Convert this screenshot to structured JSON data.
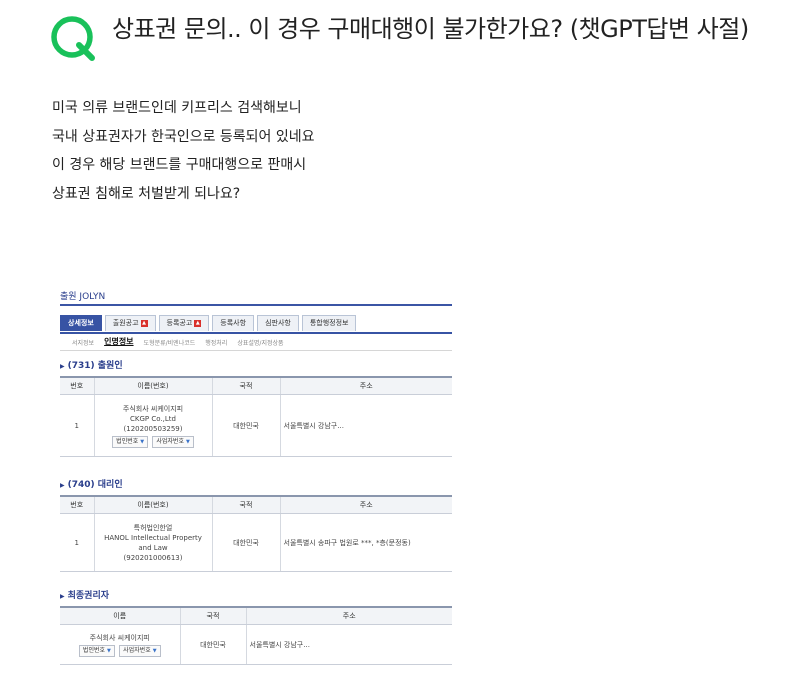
{
  "question": {
    "icon": "Q",
    "title": "상표권 문의.. 이 경우 구매대행이 불가한가요? (챗GPT답변 사절)",
    "body_lines": [
      "미국 의류 브랜드인데 키프리스 검색해보니",
      "국내 상표권자가 한국인으로 등록되어 있네요",
      "이 경우 해당 브랜드를 구매대행으로 판매시",
      "상표권 침해로 처벌받게 되나요?"
    ]
  },
  "screenshot": {
    "title": "출원 JOLYN",
    "tabs": [
      {
        "label": "상세정보",
        "active": true,
        "pdf": false
      },
      {
        "label": "출원공고",
        "active": false,
        "pdf": true
      },
      {
        "label": "등록공고",
        "active": false,
        "pdf": true
      },
      {
        "label": "등록사항",
        "active": false,
        "pdf": false
      },
      {
        "label": "심판사항",
        "active": false,
        "pdf": false
      },
      {
        "label": "통합행정정보",
        "active": false,
        "pdf": false
      }
    ],
    "subtabs": [
      {
        "label": "서지정보",
        "active": false
      },
      {
        "label": "인명정보",
        "active": true
      },
      {
        "label": "도형분류/비엔나코드",
        "active": false
      },
      {
        "label": "행정처리",
        "active": false
      },
      {
        "label": "상표설명/지정상품",
        "active": false
      }
    ],
    "applicant": {
      "heading": "(731) 출원인",
      "headers": [
        "번호",
        "이름(번호)",
        "국적",
        "주소"
      ],
      "row": {
        "no": "1",
        "name_lines": [
          "주식회사 씨케이지피",
          "CKGP Co.,Ltd",
          "(120200503259)"
        ],
        "buttons": [
          "법인번호",
          "사업자번호"
        ],
        "nationality": "대한민국",
        "address": "서울특별시 강남구..."
      }
    },
    "agent": {
      "heading": "(740) 대리인",
      "headers": [
        "번호",
        "이름(번호)",
        "국적",
        "주소"
      ],
      "row": {
        "no": "1",
        "name_lines": [
          "특허법인한얼",
          "HANOL Intellectual Property",
          "and Law",
          "(920201000613)"
        ],
        "nationality": "대한민국",
        "address": "서울특별시 송파구 법원로 ***, *층(문정동)"
      }
    },
    "owner": {
      "heading": "최종권리자",
      "headers": [
        "이름",
        "국적",
        "주소"
      ],
      "row": {
        "name": "주식회사 씨케이지피",
        "buttons": [
          "법인번호",
          "사업자번호"
        ],
        "nationality": "대한민국",
        "address": "서울특별시 강남구..."
      }
    }
  },
  "colors": {
    "q_icon": "#19c15a",
    "kipris_blue": "#3753a4",
    "heading_blue": "#2a3e8c"
  }
}
